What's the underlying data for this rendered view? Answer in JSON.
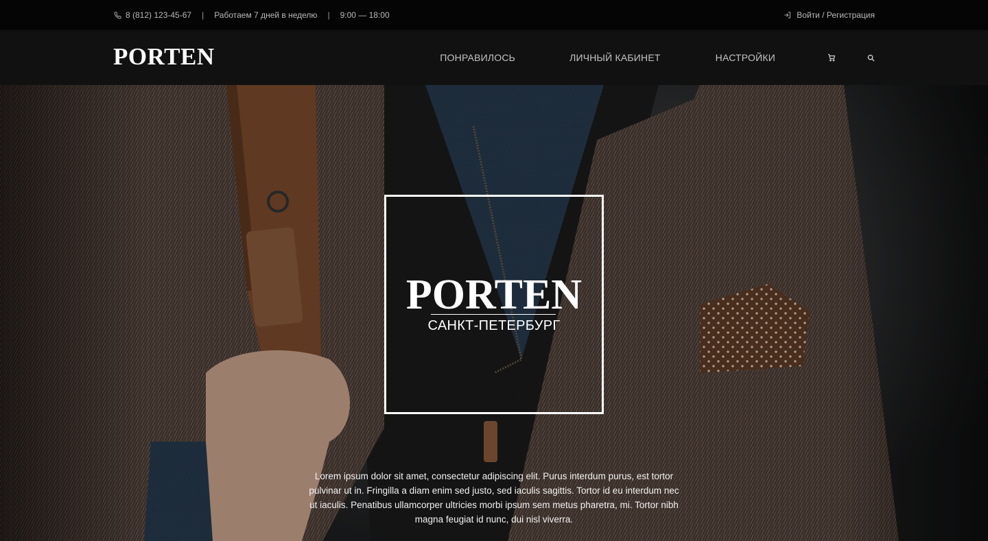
{
  "topbar": {
    "phone": "8 (812) 123-45-67",
    "sep1": "|",
    "schedule": "Работаем 7 дней в неделю",
    "sep2": "|",
    "hours": "9:00 — 18:00",
    "login": "Войти / Регистрация",
    "phone_icon": "phone-icon",
    "login_icon": "login-icon"
  },
  "header": {
    "logo": "PORTEN",
    "nav": [
      "ПОНРАВИЛОСЬ",
      "ЛИЧНЫЙ КАБИНЕТ",
      "НАСТРОЙКИ"
    ],
    "cart_icon": "cart-icon",
    "search_icon": "search-icon"
  },
  "hero": {
    "title": "PORTEN",
    "city": "САНКТ-ПЕТЕРБУРГ",
    "description": "Lorem ipsum dolor sit amet, consectetur adipiscing elit. Purus interdum purus, est tortor pulvinar ut in. Fringilla a diam enim sed justo, sed iaculis sagittis. Tortor id eu interdum nec ut iaculis. Penatibus ullamcorper ultricies morbi ipsum sem metus pharetra, mi. Tortor nibh magna feugiat id nunc, dui nisl viverra."
  },
  "colors": {
    "topbar_bg": "#050505",
    "header_bg": "#111111",
    "nav_text": "#c4c4c4",
    "accent": "#ffffff"
  }
}
